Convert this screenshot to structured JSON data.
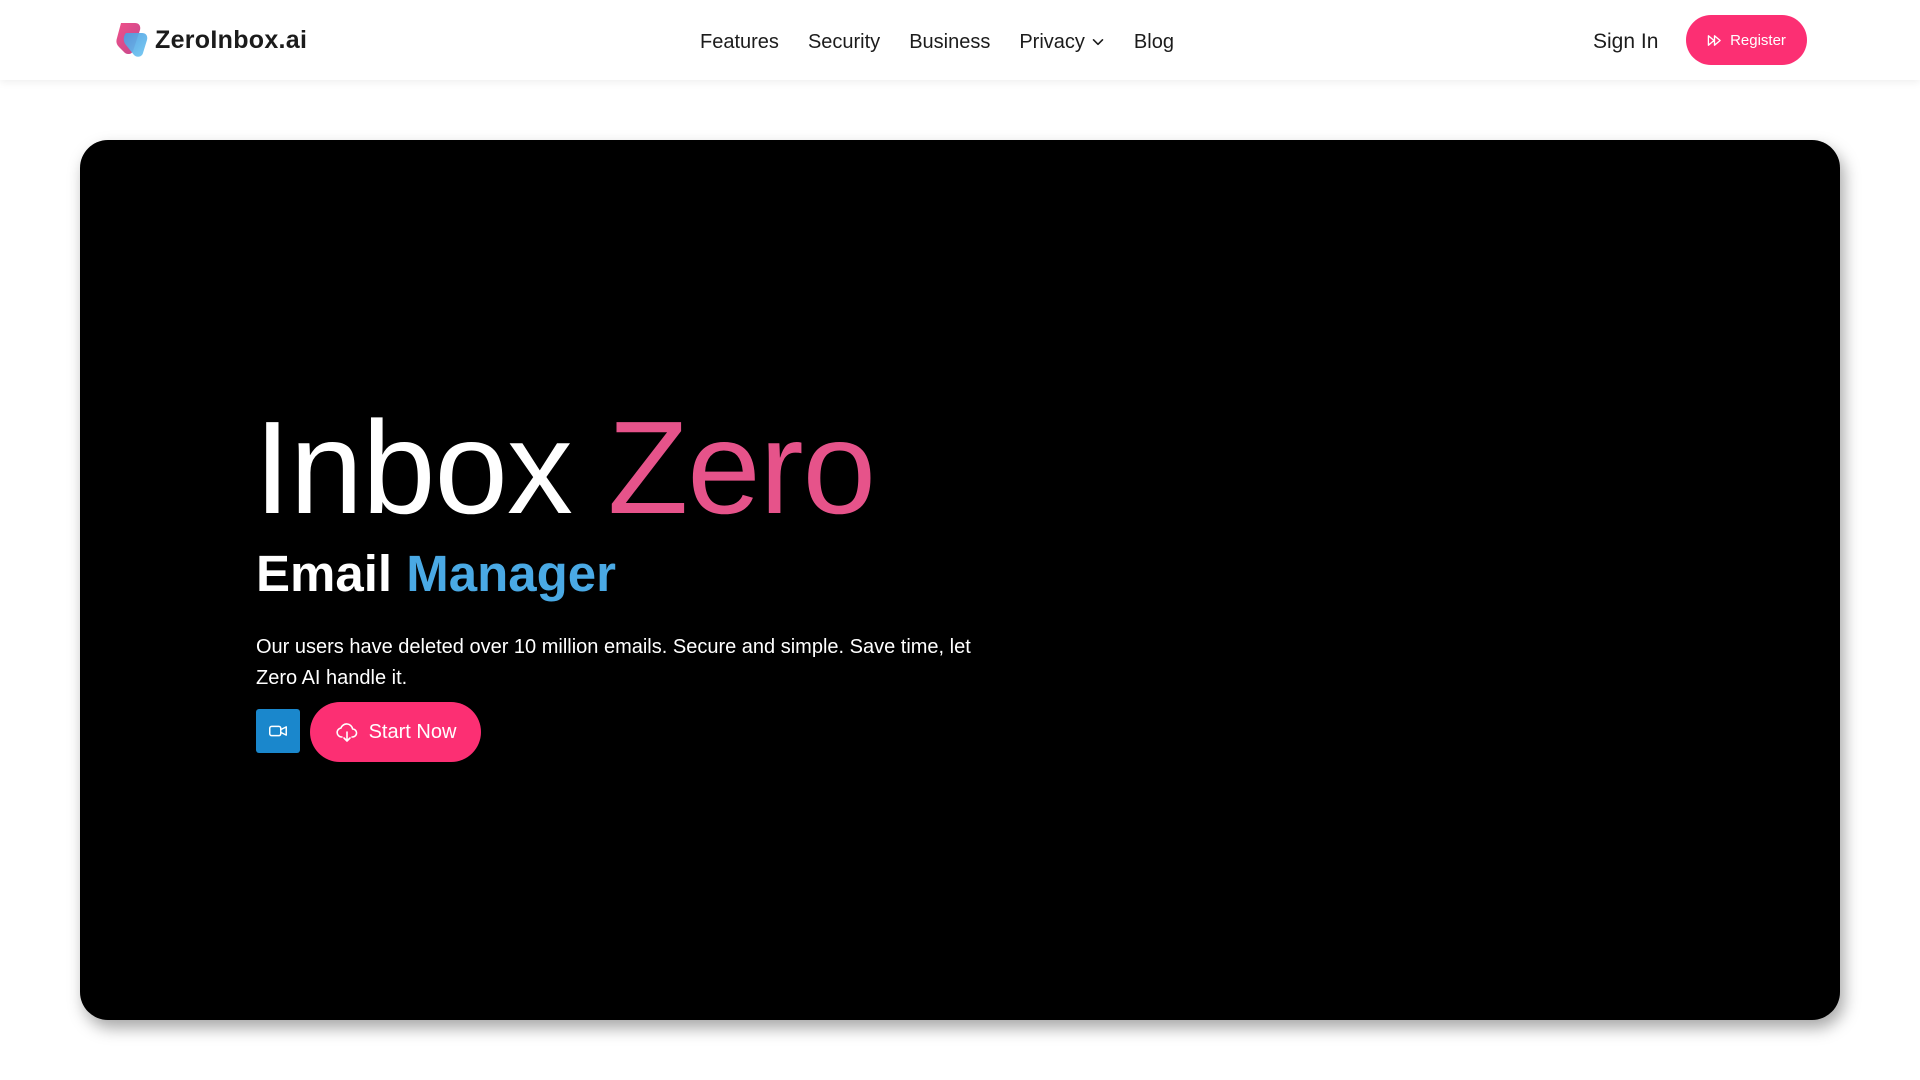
{
  "brand": {
    "name": "ZeroInbox.ai",
    "logo_icon": "zeroinbox-logo"
  },
  "nav": {
    "links": [
      {
        "label": "Features"
      },
      {
        "label": "Security"
      },
      {
        "label": "Business"
      },
      {
        "label": "Privacy",
        "icon": "chevron-down-icon"
      },
      {
        "label": "Blog"
      }
    ],
    "sign_in": "Sign In",
    "register": {
      "label": "Register",
      "icon": "fast-forward-icon"
    }
  },
  "hero": {
    "title_part1": "Inbox",
    "title_part2": "Zero",
    "subtitle_part1": "Email",
    "subtitle_part2": "Manager",
    "description": "Our users have deleted over 10 million emails. Secure and simple. Save time, let Zero AI handle it.",
    "video_button": {
      "icon": "video-camera-icon"
    },
    "start_button": {
      "label": "Start Now",
      "icon": "cloud-download-icon"
    }
  },
  "colors": {
    "accent_pink": "#fc2f73",
    "title_pink": "#e6538a",
    "title_blue": "#4aa9e4",
    "video_blue": "#1a87cc",
    "hero_bg": "#000000"
  }
}
